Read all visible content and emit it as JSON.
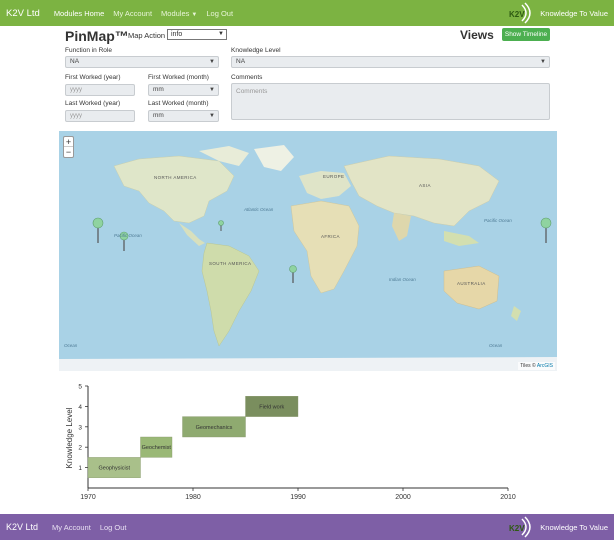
{
  "navbar": {
    "brand": "K2V Ltd",
    "links": [
      {
        "label": "Modules Home"
      },
      {
        "label": "My Account"
      },
      {
        "label": "Modules"
      },
      {
        "label": "Log Out"
      }
    ],
    "logo_text": "Knowledge To Value",
    "logo_badge": "K2V",
    "color": "#7cb342"
  },
  "header": {
    "title": "PinMap™",
    "map_action_label": "Map Action",
    "map_action_value": "info",
    "views_title": "Views",
    "show_timeline_label": "Show Timeline"
  },
  "form": {
    "function_in_role_label": "Function in Role",
    "function_in_role_value": "NA",
    "knowledge_level_label": "Knowledge Level",
    "knowledge_level_value": "NA",
    "first_worked_year_label": "First Worked (year)",
    "first_worked_year_placeholder": "yyyy",
    "first_worked_month_label": "First Worked (month)",
    "first_worked_month_value": "mm",
    "last_worked_year_label": "Last Worked (year)",
    "last_worked_year_placeholder": "yyyy",
    "last_worked_month_label": "Last Worked (month)",
    "last_worked_month_value": "mm",
    "comments_label": "Comments",
    "comments_placeholder": "Comments"
  },
  "map": {
    "zoom_in": "+",
    "zoom_out": "−",
    "attribution_prefix": "Tiles ©",
    "attribution_link": "ArcGIS",
    "continent_labels": [
      "NORTH AMERICA",
      "EUROPE",
      "ASIA",
      "AFRICA",
      "SOUTH AMERICA",
      "AUSTRALIA"
    ],
    "ocean_labels": [
      "Pacific Ocean",
      "Atlantic Ocean",
      "Indian Ocean",
      "Pacific Ocean",
      "Ocean",
      "Ocean"
    ],
    "pin_color": "#8fd3a0"
  },
  "chart_data": {
    "type": "timeline-bar",
    "ylabel": "Knowledge Level",
    "xlim": [
      1970,
      2010
    ],
    "ylim": [
      0,
      5
    ],
    "x_ticks": [
      1970,
      1980,
      1990,
      2000,
      2010
    ],
    "y_ticks": [
      1,
      2,
      3,
      4,
      5
    ],
    "bars": [
      {
        "label": "Geophysicist",
        "start": 1970,
        "end": 1975,
        "level": 1,
        "color": "#a9c08a"
      },
      {
        "label": "Geochemist",
        "start": 1975,
        "end": 1978,
        "level": 2,
        "color": "#9ab876"
      },
      {
        "label": "Geomechanics",
        "start": 1979,
        "end": 1985,
        "level": 3,
        "color": "#8faa70"
      },
      {
        "label": "Field work",
        "start": 1985,
        "end": 1990,
        "level": 4,
        "color": "#7a8e5e"
      }
    ]
  },
  "footer": {
    "brand": "K2V Ltd",
    "links": [
      {
        "label": "My Account"
      },
      {
        "label": "Log Out"
      }
    ],
    "logo_text": "Knowledge To Value",
    "logo_badge": "K2V",
    "color": "#7e5fa6"
  }
}
